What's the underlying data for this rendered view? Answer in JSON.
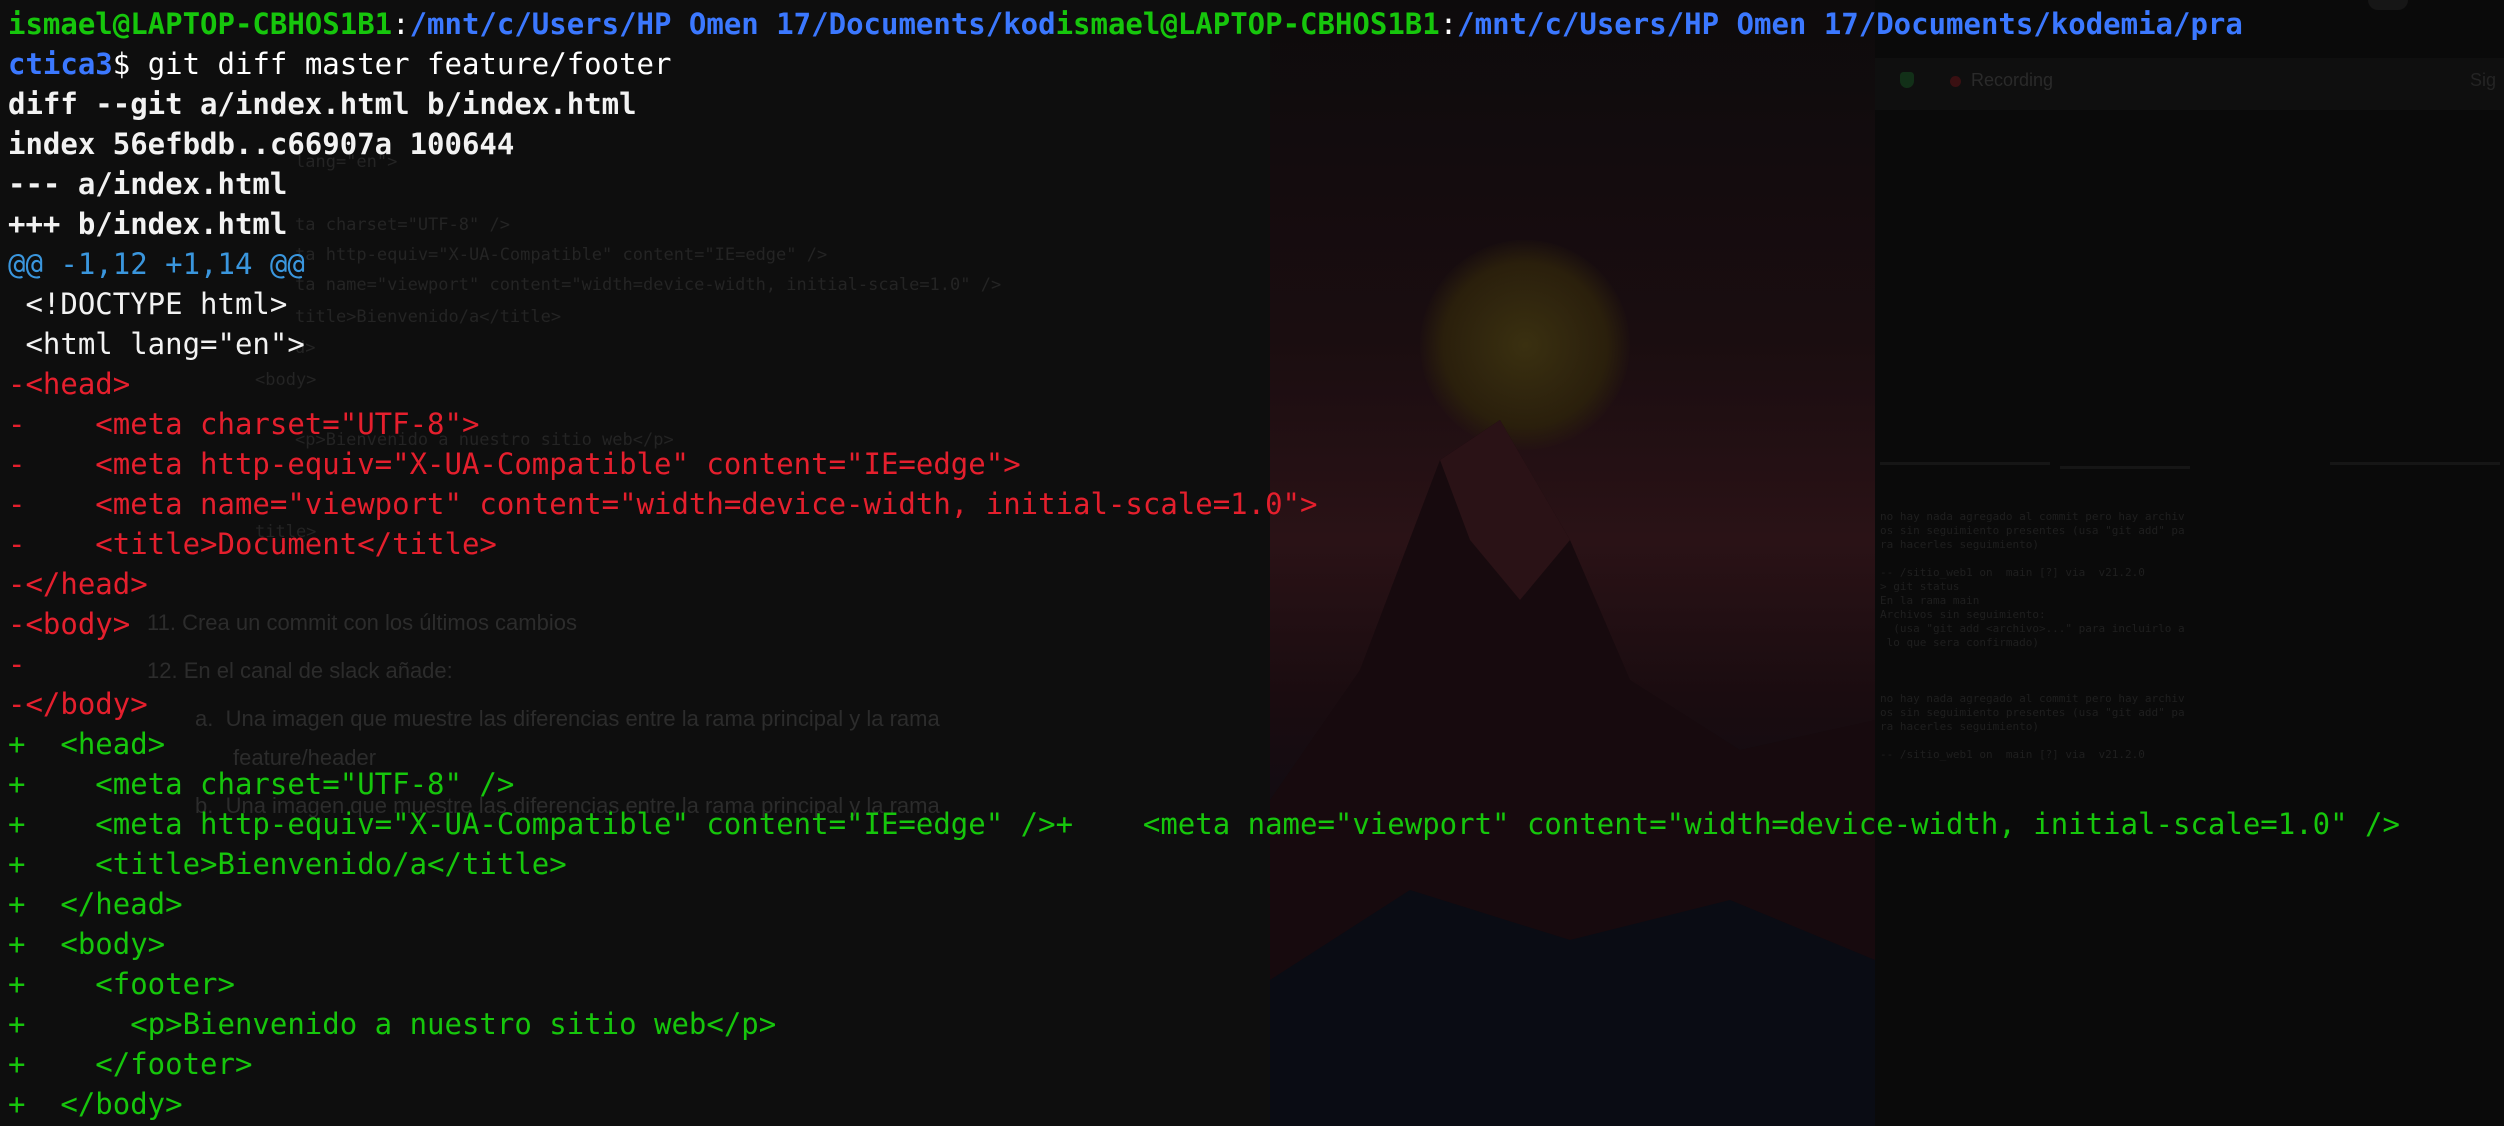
{
  "terminal": {
    "prompt_lines": [
      {
        "user1": "ismael@LAPTOP-CBHOS1B1",
        "sep1": ":",
        "path1": "/mnt/c/Users/HP Omen 17/Documents/kod",
        "user2": "ismael@LAPTOP-CBHOS1B1",
        "sep2": ":",
        "path2": "/mnt/c/Users/HP Omen 17/Documents/kodemia/pra"
      },
      {
        "path": "ctica3",
        "prompt_symbol": "$ ",
        "command": "git diff master feature/footer"
      }
    ],
    "diff_header": [
      "diff --git a/index.html b/index.html",
      "index 56efbdb..c66907a 100644",
      "--- a/index.html",
      "+++ b/index.html"
    ],
    "hunk_header": "@@ -1,12 +1,14 @@",
    "diff_lines": [
      {
        "type": "context",
        "text": " <!DOCTYPE html>"
      },
      {
        "type": "context",
        "text": " <html lang=\"en\">"
      },
      {
        "type": "removed",
        "text": "-<head>"
      },
      {
        "type": "removed",
        "text": "-    <meta charset=\"UTF-8\">"
      },
      {
        "type": "removed",
        "text": "-    <meta http-equiv=\"X-UA-Compatible\" content=\"IE=edge\">"
      },
      {
        "type": "removed",
        "text": "-    <meta name=\"viewport\" content=\"width=device-width, initial-scale=1.0\">"
      },
      {
        "type": "removed",
        "text": "-    <title>Document</title>"
      },
      {
        "type": "removed",
        "text": "-</head>"
      },
      {
        "type": "removed",
        "text": "-<body>"
      },
      {
        "type": "removed",
        "text": "-"
      },
      {
        "type": "removed",
        "text": "-</body>"
      },
      {
        "type": "added",
        "text": "+  <head>"
      },
      {
        "type": "added",
        "text": "+    <meta charset=\"UTF-8\" />"
      },
      {
        "type": "added",
        "text": "+    <meta http-equiv=\"X-UA-Compatible\" content=\"IE=edge\" />+    <meta name=\"viewport\" content=\"width=device-width, initial-scale=1.0\" />"
      },
      {
        "type": "added",
        "text": "+    <title>Bienvenido/a</title>"
      },
      {
        "type": "added",
        "text": "+  </head>"
      },
      {
        "type": "added",
        "text": "+  <body>"
      },
      {
        "type": "added",
        "text": "+    <footer>"
      },
      {
        "type": "added",
        "text": "+      <p>Bienvenido a nuestro sitio web</p>"
      },
      {
        "type": "added",
        "text": "+    </footer>"
      },
      {
        "type": "added",
        "text": "+  </body>"
      }
    ]
  },
  "background": {
    "recording_label": "Recording",
    "sign_label": "Sig",
    "document_lines": [
      "11. Crea un commit con los últimos cambios",
      "12. En el canal de slack añade:",
      "a.  Una imagen que muestre las diferencias entre la rama principal y la rama",
      "feature/header",
      "b.  Una imagen que muestre las diferencias entre la rama principal y la rama"
    ],
    "code_lines": [
      "lang=\"en\">",
      "ta charset=\"UTF-8\" />",
      "ta http-equiv=\"X-UA-Compatible\" content=\"IE=edge\" />",
      "ta name=\"viewport\" content=\"width=device-width, initial-scale=1.0\" />",
      "title>Bienvenido/a</title>",
      "d>",
      "<body>",
      "<p>Bienvenido a nuestro sitio web</p>",
      "title>"
    ],
    "mini_terminal": [
      "no hay nada agregado al commit pero hay archiv",
      "os sin seguimiento presentes (usa \"git add\" pa",
      "ra hacerles seguimiento)",
      "",
      "-- /sitio_web1 on  main [?] via  v21.2.0",
      "> git status",
      "En la rama main",
      "Archivos sin seguimiento:",
      "  (usa \"git add <archivo>...\" para incluirlo a",
      " lo que sera confirmado)",
      "",
      "",
      "",
      "no hay nada agregado al commit pero hay archiv",
      "os sin seguimiento presentes (usa \"git add\" pa",
      "ra hacerles seguimiento)",
      "",
      "-- /sitio_web1 on  main [?] via  v21.2.0"
    ]
  },
  "colors": {
    "background": "#080808",
    "user": "#16c60c",
    "path": "#3b78ff",
    "hunk": "#3a96dd",
    "removed": "#e51f2d",
    "added": "#16c60c",
    "text": "#f2f2f2"
  }
}
